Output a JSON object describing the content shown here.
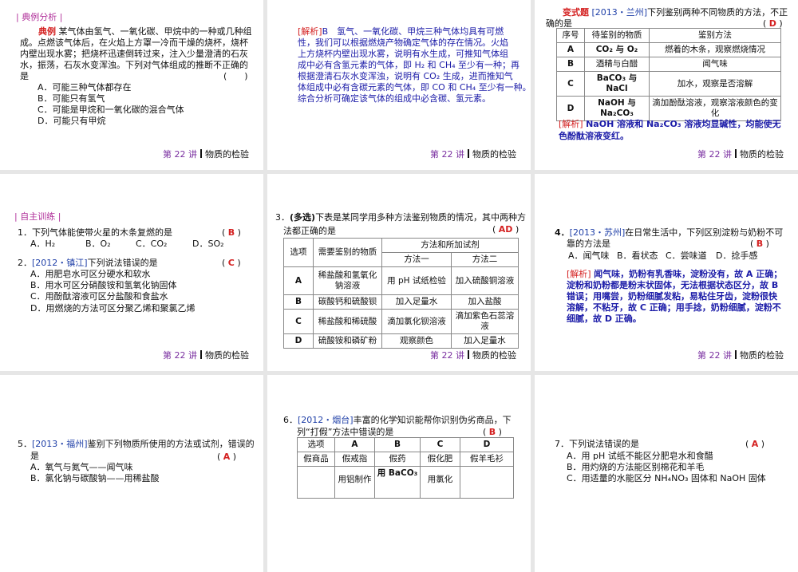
{
  "footer": {
    "num": "第 22 讲",
    "title": "物质的检验"
  },
  "s1": {
    "header": "| 典例分析 |",
    "tag": "典例",
    "lines": [
      "某气体由氢气、一氧化碳、甲烷中的一种或几种组",
      "成。点燃该气体后，在火焰上方罩一冷而干燥的烧杯，烧杯",
      "内壁出现水雾；把烧杯迅速倒转过来，注入少量澄清的石灰",
      "水，振荡，石灰水变浑浊。下列对气体组成的推断不正确的",
      "是"
    ],
    "paren": "(　　)",
    "options": [
      "A．可能三种气体都存在",
      "B．可能只有氢气",
      "C．可能是甲烷和一氧化碳的混合气体",
      "D．可能只有甲烷"
    ]
  },
  "s2": {
    "tag": "[解析]",
    "lines": [
      "B　氢气、一氧化碳、甲烷三种气体均具有可燃",
      "性，我们可以根据燃烧产物确定气体的存在情况。火焰",
      "上方烧杯内壁出现水雾，说明有水生成，可推知气体组",
      "成中必有含氢元素的气体，即 H₂ 和 CH₄ 至少有一种；再",
      "根据澄清石灰水变浑浊，说明有 CO₂ 生成，进而推知气",
      "体组成中必有含碳元素的气体，即 CO 和 CH₄ 至少有一种。",
      "综合分析可确定该气体的组成中必含碳、氢元素。"
    ]
  },
  "s3": {
    "tag": "变式题",
    "source": "[2013・兰州]",
    "line1": "下列鉴别两种不同物质的方法，不正",
    "line2": "确的是",
    "answer": "D",
    "table": {
      "headers": [
        "序号",
        "待鉴别的物质",
        "鉴别方法"
      ],
      "rows": [
        [
          "A",
          "CO₂ 与 O₂",
          "燃着的木条，观察燃烧情况"
        ],
        [
          "B",
          "酒精与白醋",
          "闻气味"
        ],
        [
          "C",
          "BaCO₃ 与 NaCl",
          "加水，观察是否溶解"
        ],
        [
          "D",
          "NaOH 与 Na₂CO₃",
          "滴加酚酞溶液，观察溶液颜色的变化"
        ]
      ]
    },
    "analysis_tag": "[解析]",
    "analysis": [
      "NaOH 溶液和 Na₂CO₃ 溶液均显碱性，均能使无",
      "色酚酞溶液变红。"
    ]
  },
  "s4": {
    "header": "| 自主训练 |",
    "q1": "1．下列气体能使带火星的木条复燃的是",
    "a1": "B",
    "q1opts": [
      "A．H₂",
      "B．O₂",
      "C．CO₂",
      "D．SO₂"
    ],
    "q2num": "2．",
    "q2src": "[2012・镇江]",
    "q2": "下列说法错误的是",
    "a2": "C",
    "q2opts": [
      "A．用肥皂水可区分硬水和软水",
      "B．用水可区分硝酸铵和氢氧化钠固体",
      "C．用酚酞溶液可区分盐酸和食盐水",
      "D．用燃烧的方法可区分聚乙烯和聚氯乙烯"
    ]
  },
  "s5": {
    "num": "3．",
    "multi": "(多选)",
    "line1": "下表是某同学用多种方法鉴别物质的情况，其中两种方",
    "line2": "法都正确的是",
    "answer": "AD",
    "table": {
      "h1": "选项",
      "h2": "需要鉴别的物质",
      "h3": "方法和所加试剂",
      "m1": "方法一",
      "m2": "方法二",
      "rows": [
        [
          "A",
          "稀盐酸和氢氧化钠溶液",
          "用 pH 试纸检验",
          "加入硫酸铜溶液"
        ],
        [
          "B",
          "碳酸钙和硫酸钡",
          "加入足量水",
          "加入盐酸"
        ],
        [
          "C",
          "稀盐酸和稀硫酸",
          "滴加氯化钡溶液",
          "滴加紫色石蕊溶液"
        ],
        [
          "D",
          "硫酸铵和磷矿粉",
          "观察颜色",
          "加入足量水"
        ]
      ]
    }
  },
  "s6": {
    "num": "4．",
    "src": "[2013・苏州]",
    "line1": "在日常生活中，下列区别淀粉与奶粉不可",
    "line2": "靠的方法是",
    "answer": "B",
    "opts": [
      "A．闻气味",
      "B．看状态",
      "C．尝味道",
      "D．捻手感"
    ],
    "analysis_tag": "[解析]",
    "analysis": [
      "闻气味，奶粉有乳香味，淀粉没有，故 A 正确；",
      "淀粉和奶粉都是粉末状固体，无法根据状态区分，故 B",
      "错误；用嘴尝，奶粉细腻发粘，易粘住牙齿，淀粉很快",
      "溶解，不粘牙，故 C 正确；用手捻，奶粉细腻，淀粉不",
      "细腻，故 D 正确。"
    ]
  },
  "s7": {
    "num": "5．",
    "src": "[2013・福州]",
    "line1": "鉴别下列物质所使用的方法或试剂，错误的",
    "line2": "是",
    "answer": "A",
    "opts": [
      "A．氧气与氮气——闻气味",
      "B．氯化钠与碳酸钠——用稀盐酸"
    ]
  },
  "s8": {
    "num": "6．",
    "src": "[2012・烟台]",
    "line1": "丰富的化学知识能帮你识别伪劣商品，下",
    "line2": "列“打假”方法中错误的是",
    "answer": "B",
    "table": {
      "headers": [
        "选项",
        "A",
        "B",
        "C",
        "D"
      ],
      "row1": [
        "假商品",
        "假戒指",
        "假药",
        "假化肥",
        "假羊毛衫"
      ],
      "row2": [
        "",
        "用铝制作",
        "用 BaCO₃",
        "用氯化",
        ""
      ]
    }
  },
  "s9": {
    "q": "7．下列说法错误的是",
    "answer": "A",
    "opts": [
      "A．用 pH 试纸不能区分肥皂水和食醋",
      "B．用灼烧的方法能区别棉花和羊毛",
      "C．用适量的水能区分 NH₄NO₃ 固体和 NaOH 固体"
    ]
  }
}
